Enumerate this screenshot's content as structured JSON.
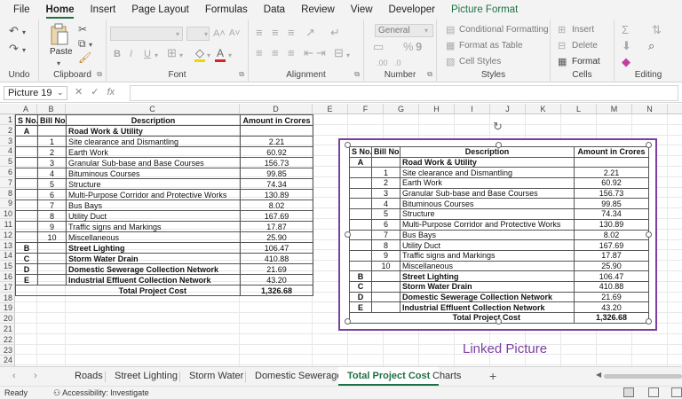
{
  "menu": {
    "tabs": [
      {
        "label": "File"
      },
      {
        "label": "Home"
      },
      {
        "label": "Insert"
      },
      {
        "label": "Page Layout"
      },
      {
        "label": "Formulas"
      },
      {
        "label": "Data"
      },
      {
        "label": "Review"
      },
      {
        "label": "View"
      },
      {
        "label": "Developer"
      },
      {
        "label": "Picture Format"
      }
    ],
    "active": "Home"
  },
  "ribbon": {
    "undo_label": "Undo",
    "clipboard_label": "Clipboard",
    "paste_label": "Paste",
    "font_label": "Font",
    "alignment_label": "Alignment",
    "number_label": "Number",
    "number_format": "General",
    "styles_label": "Styles",
    "conditional_formatting": "Conditional Formatting",
    "format_as_table": "Format as Table",
    "cell_styles": "Cell Styles",
    "cells_label": "Cells",
    "insert_label": "Insert",
    "delete_label": "Delete",
    "format_label": "Format",
    "editing_label": "Editing",
    "font_color": "#e02020",
    "fill_color": "#f5d300"
  },
  "formula_bar": {
    "name_box": "Picture 19",
    "fx": "fx",
    "formula": ""
  },
  "grid": {
    "columns": [
      "A",
      "B",
      "C",
      "D",
      "E",
      "F",
      "G",
      "H",
      "I",
      "J",
      "K",
      "L",
      "M",
      "N"
    ],
    "rows": [
      "1",
      "2",
      "3",
      "4",
      "5",
      "6",
      "7",
      "8",
      "9",
      "10",
      "11",
      "12",
      "13",
      "14",
      "15",
      "16",
      "17",
      "18",
      "19",
      "20",
      "21",
      "22",
      "23",
      "24"
    ]
  },
  "table": {
    "headers": [
      "S No.",
      "Bill No.",
      "Description",
      "Amount in Crores"
    ],
    "rows": [
      {
        "sno": "A",
        "bill": "",
        "desc": "Road Work & Utility",
        "amount": "",
        "bold": true
      },
      {
        "sno": "",
        "bill": "1",
        "desc": "Site clearance and Dismantling",
        "amount": "2.21",
        "bold": false
      },
      {
        "sno": "",
        "bill": "2",
        "desc": "Earth Work",
        "amount": "60.92",
        "bold": false
      },
      {
        "sno": "",
        "bill": "3",
        "desc": "Granular Sub-base and Base Courses",
        "amount": "156.73",
        "bold": false
      },
      {
        "sno": "",
        "bill": "4",
        "desc": "Bituminous Courses",
        "amount": "99.85",
        "bold": false
      },
      {
        "sno": "",
        "bill": "5",
        "desc": "Structure",
        "amount": "74.34",
        "bold": false
      },
      {
        "sno": "",
        "bill": "6",
        "desc": "Multi-Purpose Corridor and Protective Works",
        "amount": "130.89",
        "bold": false
      },
      {
        "sno": "",
        "bill": "7",
        "desc": "Bus Bays",
        "amount": "8.02",
        "bold": false
      },
      {
        "sno": "",
        "bill": "8",
        "desc": "Utility Duct",
        "amount": "167.69",
        "bold": false
      },
      {
        "sno": "",
        "bill": "9",
        "desc": "Traffic signs and Markings",
        "amount": "17.87",
        "bold": false
      },
      {
        "sno": "",
        "bill": "10",
        "desc": "Miscellaneous",
        "amount": "25.90",
        "bold": false
      },
      {
        "sno": "B",
        "bill": "",
        "desc": "Street Lighting",
        "amount": "106.47",
        "bold": true
      },
      {
        "sno": "C",
        "bill": "",
        "desc": "Storm Water Drain",
        "amount": "410.88",
        "bold": true
      },
      {
        "sno": "D",
        "bill": "",
        "desc": "Domestic Sewerage Collection Network",
        "amount": "21.69",
        "bold": true
      },
      {
        "sno": "E",
        "bill": "",
        "desc": "Industrial Effluent Collection Network",
        "amount": "43.20",
        "bold": true
      }
    ],
    "total_label": "Total Project Cost",
    "total_amount": "1,326.68"
  },
  "linked_picture_label": "Linked Picture",
  "sheets": {
    "tabs": [
      {
        "label": "Roads"
      },
      {
        "label": "Street Lighting"
      },
      {
        "label": "Storm Water"
      },
      {
        "label": "Domestic Sewerage"
      },
      {
        "label": "Total Project Cost"
      },
      {
        "label": "Charts"
      }
    ],
    "active": "Total Project Cost"
  },
  "status": {
    "ready": "Ready",
    "accessibility": "Accessibility: Investigate"
  },
  "colors": {
    "accent_green": "#1e7145",
    "picture_border": "#7a3fa0"
  }
}
